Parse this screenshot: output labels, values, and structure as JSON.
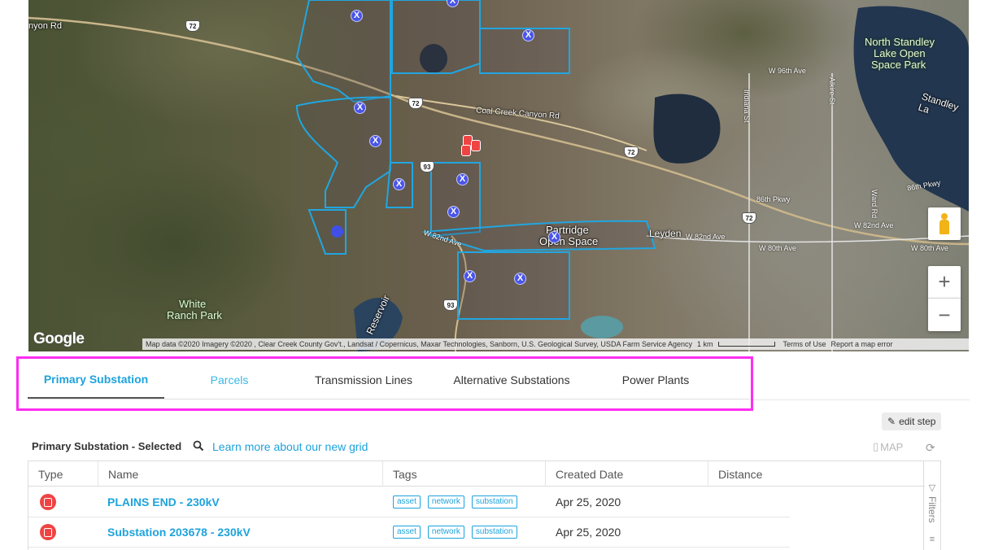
{
  "map": {
    "labels": {
      "canyon_rd": "nyon Rd",
      "north_standley": "North Standley",
      "lake_open": "Lake Open",
      "space_park": "Space Park",
      "standley": "Standley La",
      "w96th": "W 96th Ave",
      "coal_creek": "Coal Creek Canyon Rd",
      "partridge": "Partridge",
      "open_space": "Open Space",
      "leyden": "Leyden",
      "w82nd_ave": "W 82nd Ave",
      "w82nd_ave_left": "W 82nd Ave",
      "w82nd_ave_right": "W 82nd Ave",
      "w80th": "W 80th Ave",
      "86th_pkwy": "86th Pkwy",
      "86th_pkwy_right": "86th Pkwy",
      "w80th_ave": "W 80th Ave",
      "white": "White",
      "ranch_park": "Ranch Park",
      "reservoir": "Reservoir",
      "indiana_st": "Indiana St",
      "alkire_st": "Alkire St",
      "ward_rd": "Ward Rd"
    },
    "shields": [
      "72",
      "72",
      "72",
      "93",
      "93",
      "72"
    ],
    "marker_glyph": "X",
    "google": "Google",
    "attribution": {
      "data": "Map data ©2020 Imagery ©2020 , Clear Creek County Gov't., Landsat / Copernicus, Maxar Technologies, Sanborn, U.S. Geological Survey, USDA Farm Service Agency",
      "scale": "1 km",
      "terms": "Terms of Use",
      "report": "Report a map error"
    },
    "zoom_in": "+",
    "zoom_out": "−"
  },
  "tabs": [
    {
      "label": "Primary Substation",
      "state": "active"
    },
    {
      "label": "Parcels",
      "state": "link"
    },
    {
      "label": "Transmission Lines",
      "state": "normal"
    },
    {
      "label": "Alternative Substations",
      "state": "normal"
    },
    {
      "label": "Power Plants",
      "state": "normal"
    }
  ],
  "toolbar": {
    "edit_step": "edit step",
    "section_title": "Primary Substation - Selected",
    "learn_more": "Learn more about our new grid",
    "map_label": "MAP"
  },
  "table": {
    "columns": [
      "Type",
      "Name",
      "Tags",
      "Created Date",
      "Distance"
    ],
    "rows": [
      {
        "name": "PLAINS END - 230kV",
        "tags": [
          "asset",
          "network",
          "substation"
        ],
        "created": "Apr 25, 2020",
        "distance": ""
      },
      {
        "name": "Substation 203678 - 230kV",
        "tags": [
          "asset",
          "network",
          "substation"
        ],
        "created": "Apr 25, 2020",
        "distance": ""
      }
    ],
    "filters_label": "Filters"
  },
  "colors": {
    "accent": "#1ea3dc",
    "highlight_box": "#ff2df3",
    "substation_red": "#ef4444",
    "marker_blue": "#4a55e8",
    "parcel_outline": "#21a6e0"
  }
}
